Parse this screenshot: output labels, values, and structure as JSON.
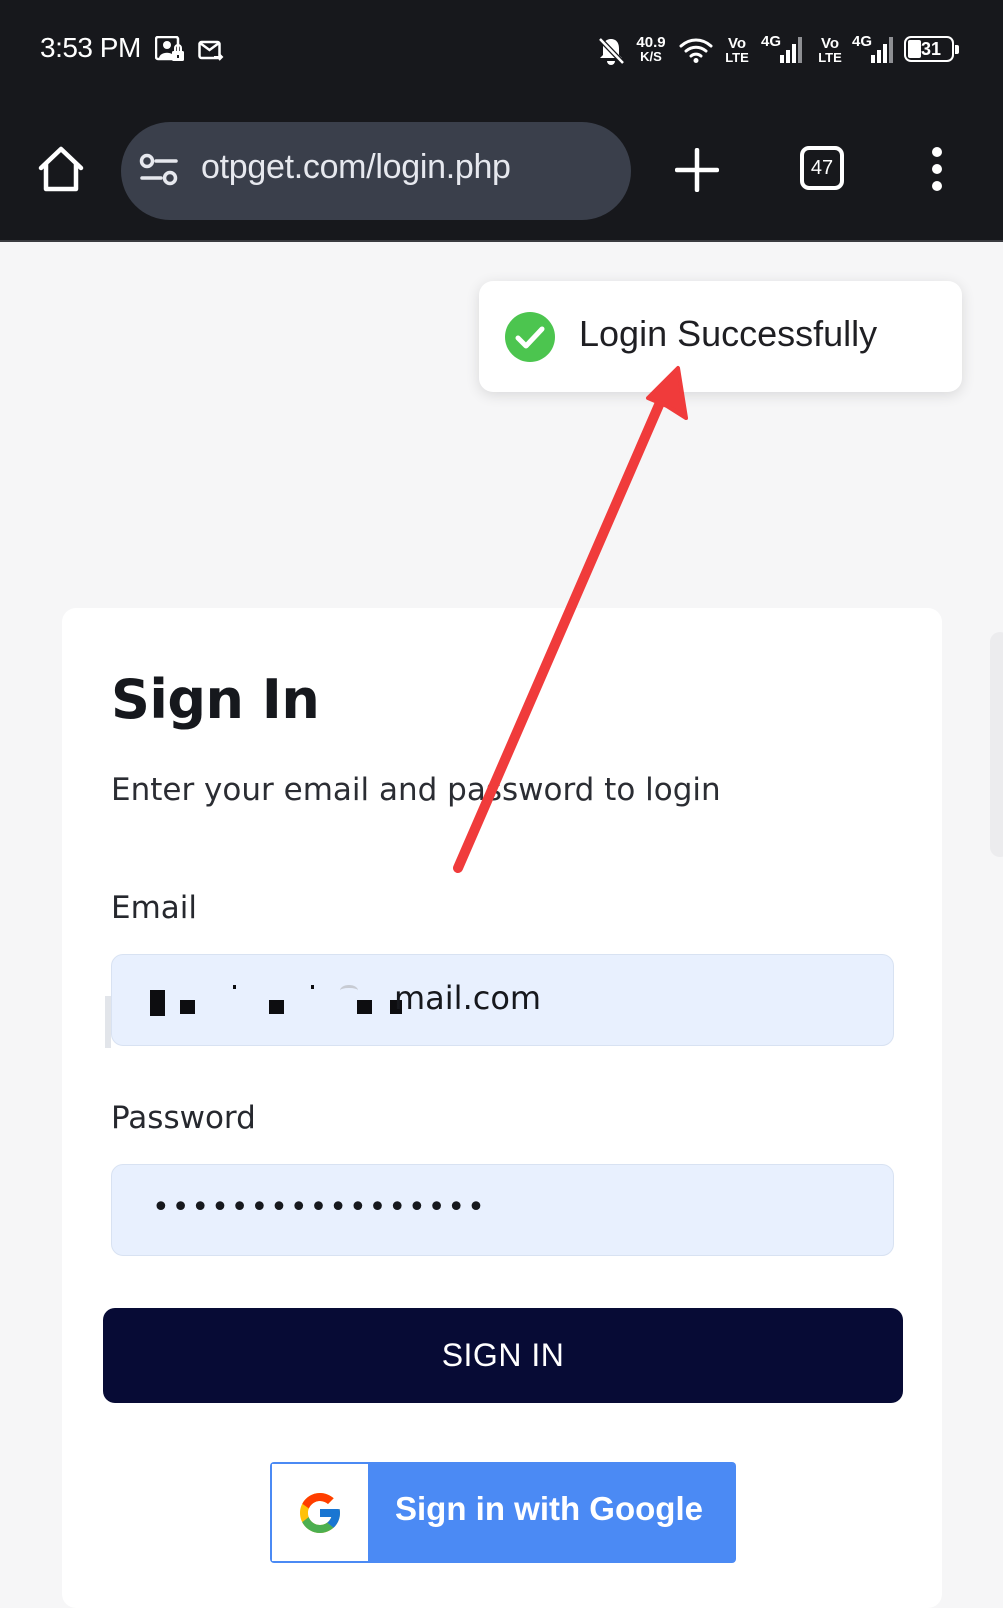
{
  "status_bar": {
    "time": "3:53 PM",
    "network_speed_value": "40.9",
    "network_speed_unit": "K/S",
    "sim1_label_top": "Vo",
    "sim1_label_bottom": "LTE",
    "sim1_net": "4G",
    "sim2_label_top": "Vo",
    "sim2_label_bottom": "LTE",
    "sim2_net": "4G",
    "battery_level": "31",
    "icons": [
      "screenshot-lock-icon",
      "message-icon",
      "bell-off-icon",
      "wifi-icon",
      "signal-icon",
      "battery-icon"
    ]
  },
  "browser": {
    "url": "otpget.com/login.php",
    "tab_count": "47",
    "icons": [
      "home-icon",
      "site-settings-icon",
      "new-tab-icon",
      "tabs-icon",
      "more-icon"
    ]
  },
  "toast": {
    "message": "Login Successfully",
    "icon": "check-circle-icon",
    "icon_color": "#4cc54f"
  },
  "form": {
    "title": "Sign In",
    "subtitle": "Enter your email and password to login",
    "email_label": "Email",
    "email_value_visible": "mail.com",
    "password_label": "Password",
    "password_value": "•••••••••••••••••",
    "submit_label": "SIGN IN",
    "google_label": "Sign in with Google"
  },
  "colors": {
    "status_bar_bg": "#17181c",
    "url_pill_bg": "#3a3f4b",
    "field_bg": "#e8f0fe",
    "signin_button": "#070b35",
    "google_button": "#4b8af4",
    "annotation_arrow": "#f03b3b"
  }
}
